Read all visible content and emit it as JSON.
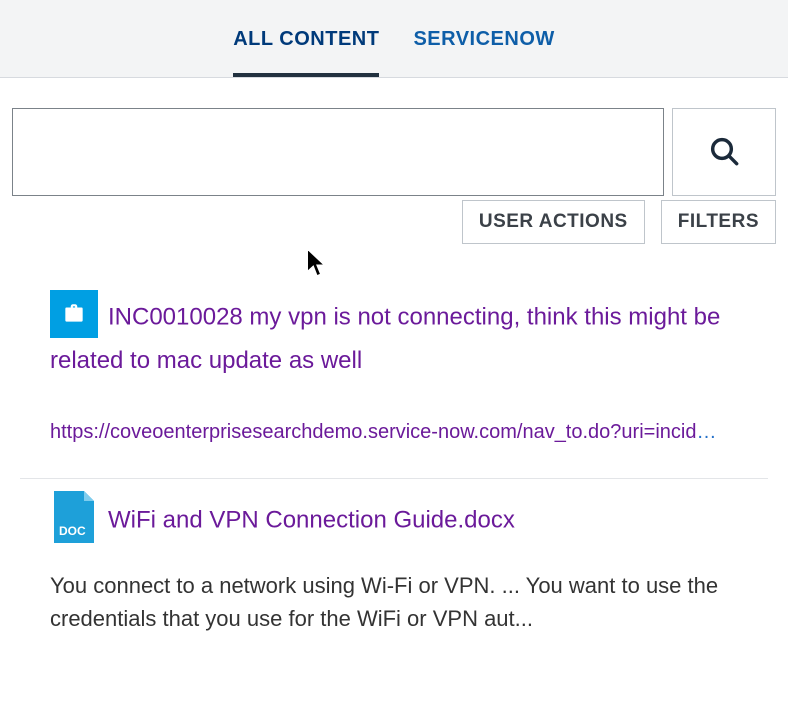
{
  "tabs": {
    "all": "ALL CONTENT",
    "servicenow": "SERVICENOW"
  },
  "search": {
    "value": "",
    "placeholder": ""
  },
  "buttons": {
    "user_actions": "USER ACTIONS",
    "filters": "FILTERS"
  },
  "results": [
    {
      "icon": "briefcase-icon",
      "title": "INC0010028 my vpn is not connecting, think this might be related to mac update as well",
      "url": "https://coveoenterprisesearchdemo.service-now.com/nav_to.do?uri=incid",
      "url_ellipsis": "…"
    },
    {
      "icon": "doc-icon",
      "doc_badge": "DOC",
      "title": "WiFi and VPN Connection Guide.docx",
      "snippet": "You connect to a network using Wi-Fi or VPN. ... You want to use the credentials that you use for the WiFi or VPN aut..."
    }
  ]
}
